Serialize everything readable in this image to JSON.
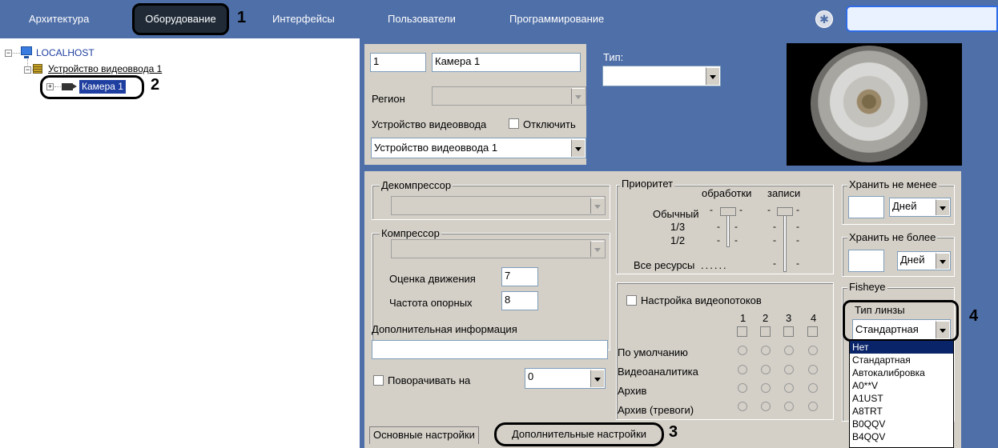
{
  "menu": {
    "items": [
      "Архитектура",
      "Оборудование",
      "Интерфейсы",
      "Пользователи",
      "Программирование"
    ],
    "active_index": 1
  },
  "callouts": [
    "1",
    "2",
    "3",
    "4"
  ],
  "tree": {
    "host": "LOCALHOST",
    "device": "Устройство видеоввода 1",
    "camera": "Камера 1"
  },
  "identity": {
    "id": "1",
    "name": "Камера 1",
    "type_label": "Тип:",
    "type_value": "",
    "region_label": "Регион",
    "region_value": "",
    "device_label": "Устройство видеоввода",
    "disable_label": "Отключить",
    "device_value": "Устройство видеоввода 1"
  },
  "decompressor": {
    "title": "Декомпрессор",
    "value": ""
  },
  "compressor": {
    "title": "Компрессор",
    "value": "",
    "motion_label": "Оценка движения",
    "motion_value": "7",
    "keyframe_label": "Частота опорных",
    "keyframe_value": "8"
  },
  "extra_info": {
    "label": "Дополнительная информация",
    "value": ""
  },
  "rotate": {
    "label": "Поворачивать на",
    "value": "0"
  },
  "priority": {
    "title": "Приоритет",
    "col_processing": "обработки",
    "col_recording": "записи",
    "level_normal": "Обычный",
    "level_third": "1/3",
    "level_half": "1/2",
    "level_all": "Все ресурсы",
    "processing_level": "Обычный",
    "recording_level": "Обычный"
  },
  "streams": {
    "title": "Настройка видеопотоков",
    "columns": [
      "1",
      "2",
      "3",
      "4"
    ],
    "rows": [
      "По умолчанию",
      "Видеоаналитика",
      "Архив",
      "Архив (тревоги)"
    ]
  },
  "store_min": {
    "title": "Хранить не менее",
    "value": "",
    "unit": "Дней"
  },
  "store_max": {
    "title": "Хранить не более",
    "value": "",
    "unit": "Дней"
  },
  "fisheye": {
    "title": "Fisheye",
    "lens_label": "Тип линзы",
    "lens_value": "Стандартная",
    "options": [
      "Нет",
      "Стандартная",
      "Автокалибровка",
      "A0**V",
      "A1UST",
      "A8TRT",
      "B0QQV",
      "B4QQV"
    ],
    "highlighted": "Нет"
  },
  "tabs": {
    "basic": "Основные настройки",
    "advanced": "Дополнительные настройки"
  },
  "colors": {
    "menu_bg": "#4f6fa8",
    "active_menu_bg": "#1f2a36",
    "panel_bg": "#d4d0c8",
    "selection": "#0a246a"
  }
}
